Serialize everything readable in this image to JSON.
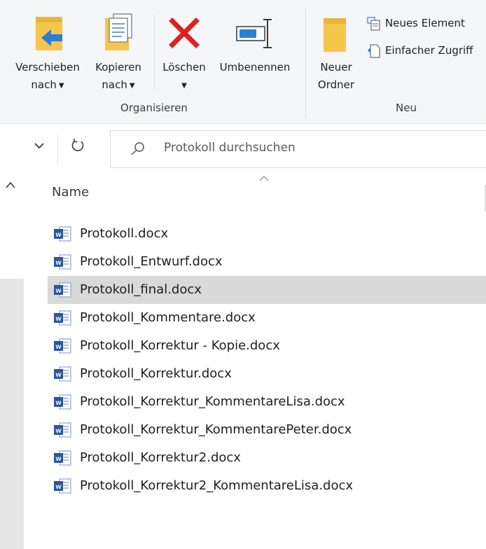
{
  "ribbon": {
    "organize": {
      "label": "Organisieren",
      "move_line1": "Verschieben",
      "move_line2": "nach",
      "copy_line1": "Kopieren",
      "copy_line2": "nach",
      "delete_label": "Löschen",
      "rename_label": "Umbenennen"
    },
    "new": {
      "label": "Neu",
      "new_folder_line1": "Neuer",
      "new_folder_line2": "Ordner",
      "new_item": "Neues Element",
      "easy_access": "Einfacher Zugriff"
    }
  },
  "search": {
    "placeholder": "Protokoll durchsuchen"
  },
  "filelist": {
    "column_name": "Name",
    "selected_index": 2,
    "files": [
      "Protokoll.docx",
      "Protokoll_Entwurf.docx",
      "Protokoll_final.docx",
      "Protokoll_Kommentare.docx",
      "Protokoll_Korrektur - Kopie.docx",
      "Protokoll_Korrektur.docx",
      "Protokoll_Korrektur_KommentareLisa.docx",
      "Protokoll_Korrektur_KommentarePeter.docx",
      "Protokoll_Korrektur2.docx",
      "Protokoll_Korrektur2_KommentareLisa.docx"
    ]
  },
  "colors": {
    "folder": "#f6c64b",
    "arrow_blue": "#2b7fd6",
    "delete_red": "#e02020",
    "word_blue": "#2b579a",
    "selection": "#d9d9d9"
  }
}
